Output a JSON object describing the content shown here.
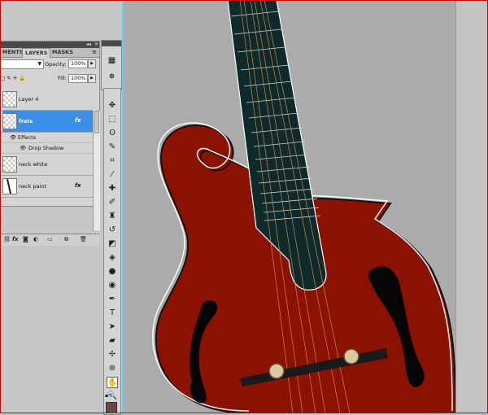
{
  "panel": {
    "tabs": [
      "MENTS",
      "LAYERS",
      "MASKS"
    ],
    "opacity_label": "Opacity:",
    "opacity_value": "100%",
    "fill_label": "Fill:",
    "fill_value": "100%"
  },
  "layers": [
    {
      "name": "Layer 4",
      "active": false,
      "fx": ""
    },
    {
      "name": "frets",
      "active": true,
      "fx": "fx"
    },
    {
      "name": "neck white",
      "active": false,
      "fx": ""
    },
    {
      "name": "neck paint",
      "active": false,
      "fx": "fx"
    }
  ],
  "effects": {
    "label": "Effects",
    "item": "Drop Shadow"
  },
  "colors": {
    "selection": "#3d8ee6",
    "body": "#8b1200",
    "neck": "#0f2a2a",
    "canvas": "#ababab",
    "foreground_swatch": "#6a4a3d"
  }
}
